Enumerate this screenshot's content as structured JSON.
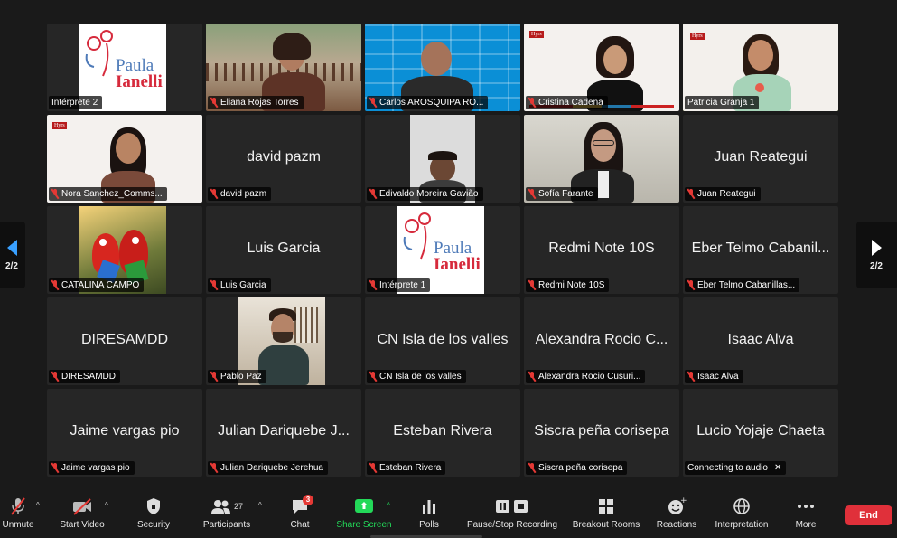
{
  "participants": [
    {
      "nametag": "Intérprete 2",
      "big_name": ""
    },
    {
      "nametag": "Eliana Rojas Torres",
      "big_name": ""
    },
    {
      "nametag": "Carlos AROSQUIPA RO...",
      "big_name": ""
    },
    {
      "nametag": "Cristina Cadena",
      "big_name": ""
    },
    {
      "nametag": "Patricia Granja 1",
      "big_name": ""
    },
    {
      "nametag": "Nora Sanchez_Comms...",
      "big_name": ""
    },
    {
      "nametag": "david pazm",
      "big_name": "david pazm"
    },
    {
      "nametag": "Edivaldo Moreira Gavião",
      "big_name": ""
    },
    {
      "nametag": "Sofía Farante",
      "big_name": ""
    },
    {
      "nametag": "Juan Reategui",
      "big_name": "Juan Reategui"
    },
    {
      "nametag": "CATALINA CAMPO",
      "big_name": ""
    },
    {
      "nametag": "Luis Garcia",
      "big_name": "Luis Garcia"
    },
    {
      "nametag": "Intérprete 1",
      "big_name": ""
    },
    {
      "nametag": "Redmi Note 10S",
      "big_name": "Redmi Note 10S"
    },
    {
      "nametag": "Eber Telmo Cabanillas...",
      "big_name": "Eber Telmo Cabanil..."
    },
    {
      "nametag": "DIRESAMDD",
      "big_name": "DIRESAMDD"
    },
    {
      "nametag": "Pablo Paz",
      "big_name": ""
    },
    {
      "nametag": "CN Isla de los valles",
      "big_name": "CN Isla de los valles"
    },
    {
      "nametag": "Alexandra Rocio Cusuri...",
      "big_name": "Alexandra Rocio C..."
    },
    {
      "nametag": "Isaac Alva",
      "big_name": "Isaac Alva"
    },
    {
      "nametag": "Jaime vargas pio",
      "big_name": "Jaime vargas pio"
    },
    {
      "nametag": "Julian Dariquebe Jerehua",
      "big_name": "Julian Dariquebe J..."
    },
    {
      "nametag": "Esteban Rivera",
      "big_name": "Esteban Rivera"
    },
    {
      "nametag": "Siscra peña corisepa",
      "big_name": "Siscra peña corisepa"
    },
    {
      "nametag": "Connecting to audio",
      "big_name": "Lucio Yojaje Chaeta"
    }
  ],
  "logo": {
    "line1": "Paula",
    "line2": "Ianelli",
    "line3": "consultoria",
    "line4": "linguística"
  },
  "pager": {
    "left": "2/2",
    "right": "2/2"
  },
  "toolbar": {
    "unmute": "Unmute",
    "start_video": "Start Video",
    "security": "Security",
    "participants": "Participants",
    "participants_count": "27",
    "chat": "Chat",
    "chat_badge": "3",
    "share_screen": "Share Screen",
    "polls": "Polls",
    "recording": "Pause/Stop Recording",
    "breakout": "Breakout Rooms",
    "reactions": "Reactions",
    "interpretation": "Interpretation",
    "more": "More",
    "end": "End"
  },
  "colors": {
    "accent_green": "#23d959",
    "active_speaker": "#c8e23a",
    "end_red": "#e0303a",
    "mute_red": "#e53935"
  }
}
